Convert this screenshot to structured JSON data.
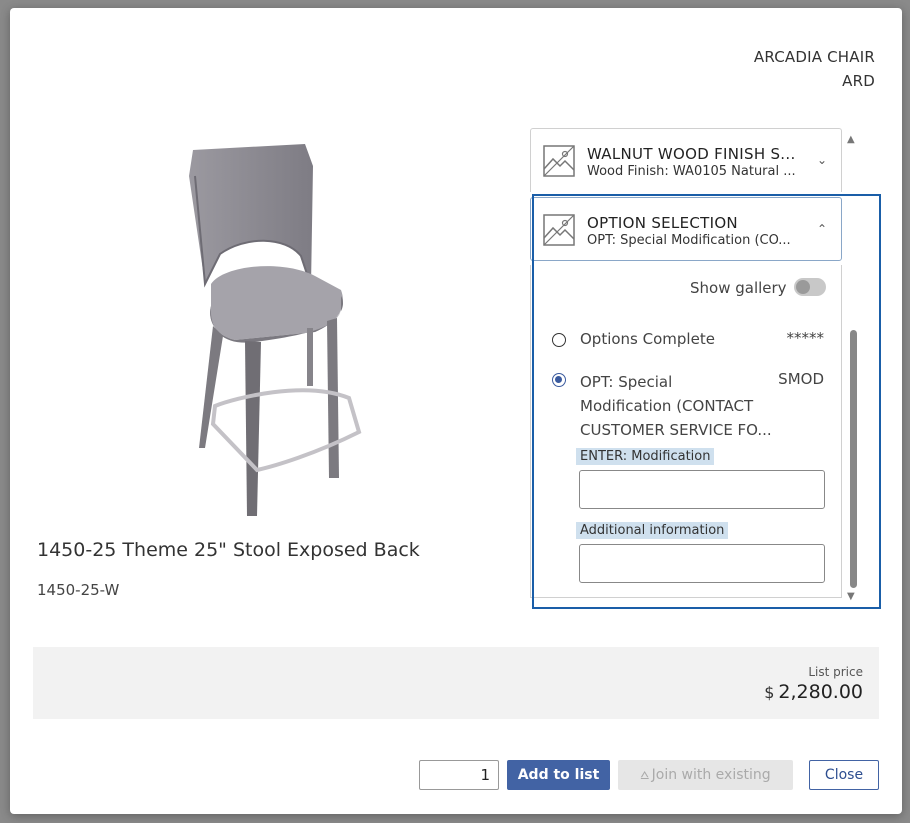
{
  "product": {
    "brand_line1": "ARCADIA CHAIR",
    "brand_line2": "ARD",
    "name": "1450-25 Theme 25\" Stool Exposed Back",
    "sku": "1450-25-W",
    "image_icon": "stool-3d-image"
  },
  "accordion": [
    {
      "title": "WALNUT WOOD FINISH S...",
      "subtitle": "Wood Finish: WA0105 Natural ...",
      "icon": "image-placeholder-icon",
      "state": "collapsed"
    },
    {
      "title": "OPTION SELECTION",
      "subtitle": "OPT: Special Modification (CO...",
      "icon": "image-placeholder-icon",
      "state": "expanded"
    }
  ],
  "options": {
    "show_gallery_label": "Show gallery",
    "show_gallery_on": false,
    "items": [
      {
        "label": "Options Complete",
        "code": "*****",
        "selected": false
      },
      {
        "label_line1": "OPT: Special",
        "label_line2": "Modification (CONTACT",
        "label_line3": "CUSTOMER SERVICE FO...",
        "code": "SMOD",
        "selected": true
      }
    ],
    "fields": [
      {
        "label": "ENTER: Modification",
        "value": ""
      },
      {
        "label": "Additional information",
        "value": ""
      }
    ]
  },
  "pricing": {
    "label": "List price",
    "currency": "$",
    "amount": "2,280.00"
  },
  "footer": {
    "quantity": "1",
    "add_label": "Add to list",
    "join_label": "Join with existing",
    "close_label": "Close"
  },
  "colors": {
    "primary": "#4263a4",
    "focus": "#1a5ea8",
    "label_highlight": "#cfe0ee"
  }
}
